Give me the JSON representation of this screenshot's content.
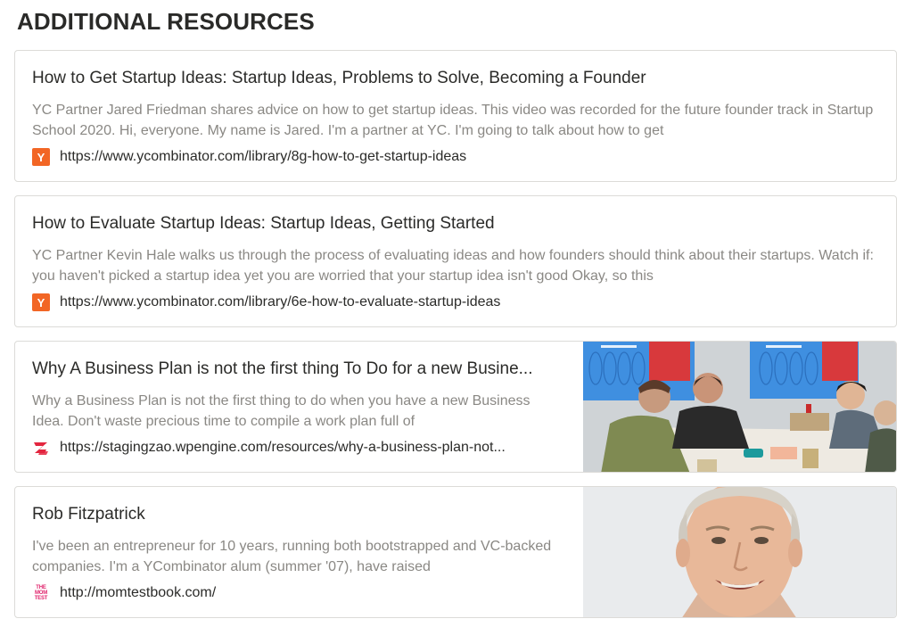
{
  "section": {
    "title": "ADDITIONAL RESOURCES"
  },
  "cards": [
    {
      "title": "How to Get Startup Ideas: Startup Ideas, Problems to Solve, Becoming a Founder",
      "description": "YC Partner Jared Friedman shares advice on how to get startup ideas. This video was recorded for the future founder track in Startup School 2020. Hi, everyone. My name is Jared. I'm a partner at YC. I'm going to talk about how to get",
      "url": "https://www.ycombinator.com/library/8g-how-to-get-startup-ideas",
      "favicon": "ycombinator-icon",
      "favicon_text": "Y"
    },
    {
      "title": "How to Evaluate Startup Ideas: Startup Ideas, Getting Started",
      "description": "YC Partner Kevin Hale walks us through the process of evaluating ideas and how founders should think about their startups. Watch if: you haven't picked a startup idea yet you are worried that your startup idea isn't good Okay, so this",
      "url": "https://www.ycombinator.com/library/6e-how-to-evaluate-startup-ideas",
      "favicon": "ycombinator-icon",
      "favicon_text": "Y"
    },
    {
      "title": "Why A Business Plan is not the first thing To Do for a new Busine...",
      "description": "Why a Business Plan is not the first thing to do when you have a new Business Idea. Don't waste precious time to compile a work plan full of",
      "url": "https://stagingzao.wpengine.com/resources/why-a-business-plan-not...",
      "favicon": "zao-logo-icon",
      "image": "workshop-photo"
    },
    {
      "title": "Rob Fitzpatrick",
      "description": "I've been an entrepreneur for 10 years, running both bootstrapped and VC-backed companies. I'm a YCombinator alum (summer '07), have raised",
      "url": "http://momtestbook.com/",
      "favicon": "mom-test-icon",
      "favicon_lines": [
        "THE",
        "MOM",
        "TEST"
      ],
      "image": "portrait-photo"
    }
  ],
  "colors": {
    "yc_orange": "#f26625",
    "zao_red": "#e3263f",
    "mom_pink": "#e0246c",
    "description_gray": "#8a8884",
    "border": "#dcdbd8"
  }
}
